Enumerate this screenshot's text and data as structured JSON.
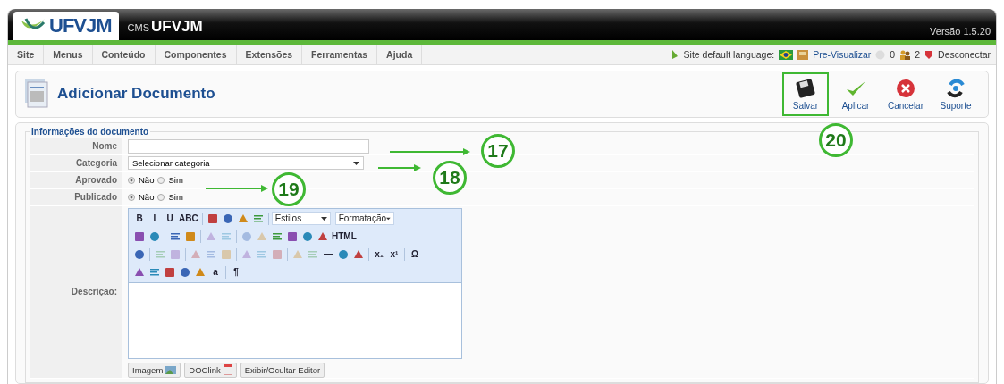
{
  "header": {
    "logo": "UFVJM",
    "cms": "CMS",
    "title": "UFVJM",
    "version": "Versão 1.5.20"
  },
  "menu": [
    {
      "label": "Site"
    },
    {
      "label": "Menus"
    },
    {
      "label": "Conteúdo"
    },
    {
      "label": "Componentes"
    },
    {
      "label": "Extensões"
    },
    {
      "label": "Ferramentas"
    },
    {
      "label": "Ajuda"
    }
  ],
  "status": {
    "language_label": "Site default language:",
    "preview": "Pre-Visualizar",
    "messages": "0",
    "users": "2",
    "logout": "Desconectar"
  },
  "page_title": "Adicionar Documento",
  "actions": [
    {
      "label": "Salvar",
      "highlighted": true
    },
    {
      "label": "Aplicar",
      "highlighted": false
    },
    {
      "label": "Cancelar",
      "highlighted": false
    },
    {
      "label": "Suporte",
      "highlighted": false
    }
  ],
  "form": {
    "legend": "Informações do documento",
    "name": {
      "label": "Nome"
    },
    "category": {
      "label": "Categoria",
      "value": "Selecionar categoria"
    },
    "radios": [
      {
        "label": "Aprovado",
        "options": [
          {
            "label": "Não",
            "selected": true
          },
          {
            "label": "Sim",
            "selected": false
          }
        ]
      },
      {
        "label": "Publicado",
        "options": [
          {
            "label": "Não",
            "selected": true
          },
          {
            "label": "Sim",
            "selected": false
          }
        ]
      }
    ],
    "description_label": "Descrição:",
    "toolbar": [
      [
        {
          "kind": "text",
          "label": "B",
          "disabled": false
        },
        {
          "kind": "text",
          "label": "I",
          "disabled": false
        },
        {
          "kind": "text",
          "label": "U",
          "disabled": false
        },
        {
          "kind": "text",
          "label": "ABC",
          "disabled": false
        },
        {
          "kind": "sep"
        },
        {
          "kind": "icon",
          "disabled": false
        },
        {
          "kind": "icon",
          "disabled": false
        },
        {
          "kind": "icon",
          "disabled": false
        },
        {
          "kind": "icon",
          "disabled": false
        },
        {
          "kind": "sep"
        },
        {
          "kind": "select",
          "label": "Estilos"
        },
        {
          "kind": "select",
          "label": "Formatação"
        }
      ],
      [
        {
          "kind": "icon",
          "disabled": false
        },
        {
          "kind": "icon",
          "disabled": false
        },
        {
          "kind": "sep"
        },
        {
          "kind": "icon",
          "disabled": false
        },
        {
          "kind": "icon",
          "disabled": false
        },
        {
          "kind": "sep"
        },
        {
          "kind": "icon",
          "disabled": true
        },
        {
          "kind": "icon",
          "disabled": true
        },
        {
          "kind": "sep"
        },
        {
          "kind": "icon",
          "disabled": true
        },
        {
          "kind": "icon",
          "disabled": true
        },
        {
          "kind": "icon",
          "disabled": false
        },
        {
          "kind": "icon",
          "disabled": false
        },
        {
          "kind": "icon",
          "disabled": false
        },
        {
          "kind": "icon",
          "disabled": false
        },
        {
          "kind": "text",
          "label": "HTML",
          "disabled": false
        }
      ],
      [
        {
          "kind": "icon",
          "disabled": false
        },
        {
          "kind": "sep"
        },
        {
          "kind": "icon",
          "disabled": true
        },
        {
          "kind": "icon",
          "disabled": true
        },
        {
          "kind": "sep"
        },
        {
          "kind": "icon",
          "disabled": true
        },
        {
          "kind": "icon",
          "disabled": true
        },
        {
          "kind": "icon",
          "disabled": true
        },
        {
          "kind": "sep"
        },
        {
          "kind": "icon",
          "disabled": true
        },
        {
          "kind": "icon",
          "disabled": true
        },
        {
          "kind": "icon",
          "disabled": true
        },
        {
          "kind": "sep"
        },
        {
          "kind": "icon",
          "disabled": true
        },
        {
          "kind": "icon",
          "disabled": true
        },
        {
          "kind": "text",
          "label": "—",
          "disabled": false
        },
        {
          "kind": "icon",
          "disabled": false
        },
        {
          "kind": "icon",
          "disabled": false
        },
        {
          "kind": "sep"
        },
        {
          "kind": "text",
          "label": "x₁",
          "disabled": false
        },
        {
          "kind": "text",
          "label": "x¹",
          "disabled": false
        },
        {
          "kind": "sep"
        },
        {
          "kind": "text",
          "label": "Ω",
          "disabled": false
        }
      ],
      [
        {
          "kind": "icon",
          "disabled": false
        },
        {
          "kind": "icon",
          "disabled": false
        },
        {
          "kind": "icon",
          "disabled": false
        },
        {
          "kind": "icon",
          "disabled": false
        },
        {
          "kind": "icon",
          "disabled": false
        },
        {
          "kind": "text",
          "label": "a",
          "disabled": false
        },
        {
          "kind": "sep"
        },
        {
          "kind": "text",
          "label": "¶",
          "disabled": false
        }
      ]
    ],
    "buttons": [
      {
        "label": "Imagem"
      },
      {
        "label": "DOClink"
      },
      {
        "label": "Exibir/Ocultar Editor"
      }
    ]
  },
  "annotations": [
    {
      "label": "17"
    },
    {
      "label": "18"
    },
    {
      "label": "19"
    },
    {
      "label": "20"
    }
  ]
}
